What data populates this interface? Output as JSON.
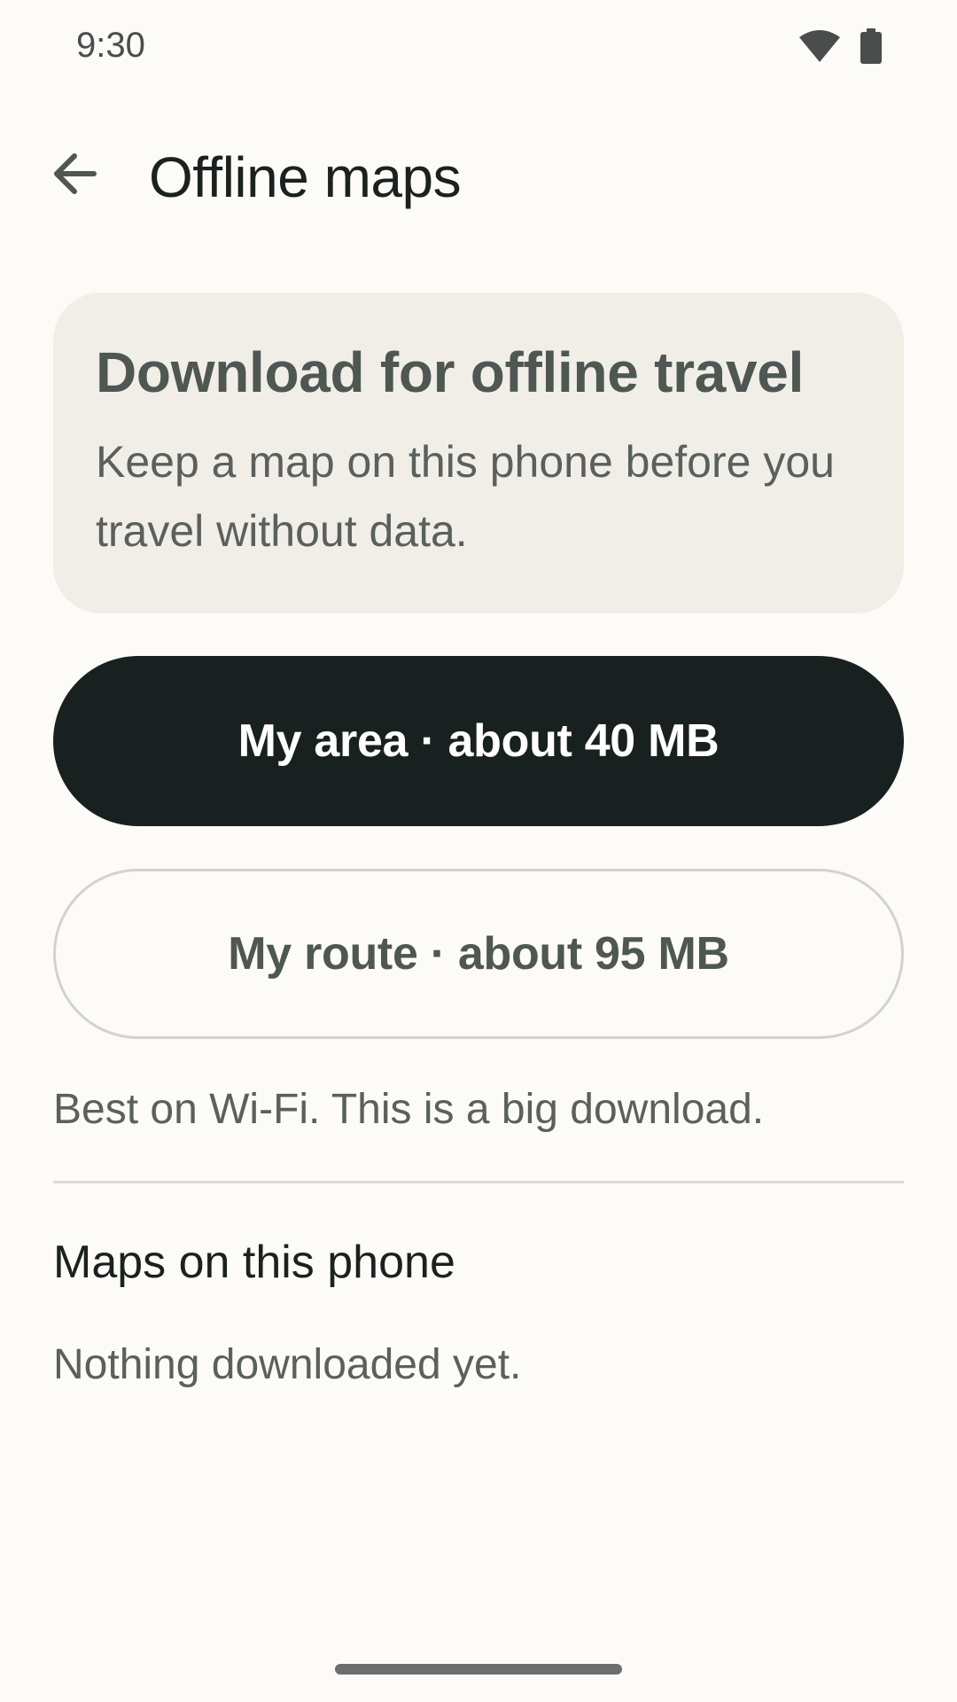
{
  "status_bar": {
    "time": "9:30",
    "icons": [
      "wifi-icon",
      "battery-icon"
    ]
  },
  "app_bar": {
    "back_icon": "arrow-back-icon",
    "title": "Offline maps"
  },
  "info_card": {
    "title": "Download for offline travel",
    "body": "Keep a map on this phone before you travel without data."
  },
  "actions": {
    "my_area_label": "My area · about 40 MB",
    "my_route_label": "My route · about 95 MB"
  },
  "hint": "Best on Wi-Fi. This is a big download.",
  "downloads": {
    "title": "Maps on this phone",
    "empty_text": "Nothing downloaded yet."
  },
  "colors": {
    "background": "#fcfbf7",
    "card": "#f1eee8",
    "primary_button": "#192120",
    "text_primary": "#1b211f",
    "text_secondary": "#5a605d"
  }
}
